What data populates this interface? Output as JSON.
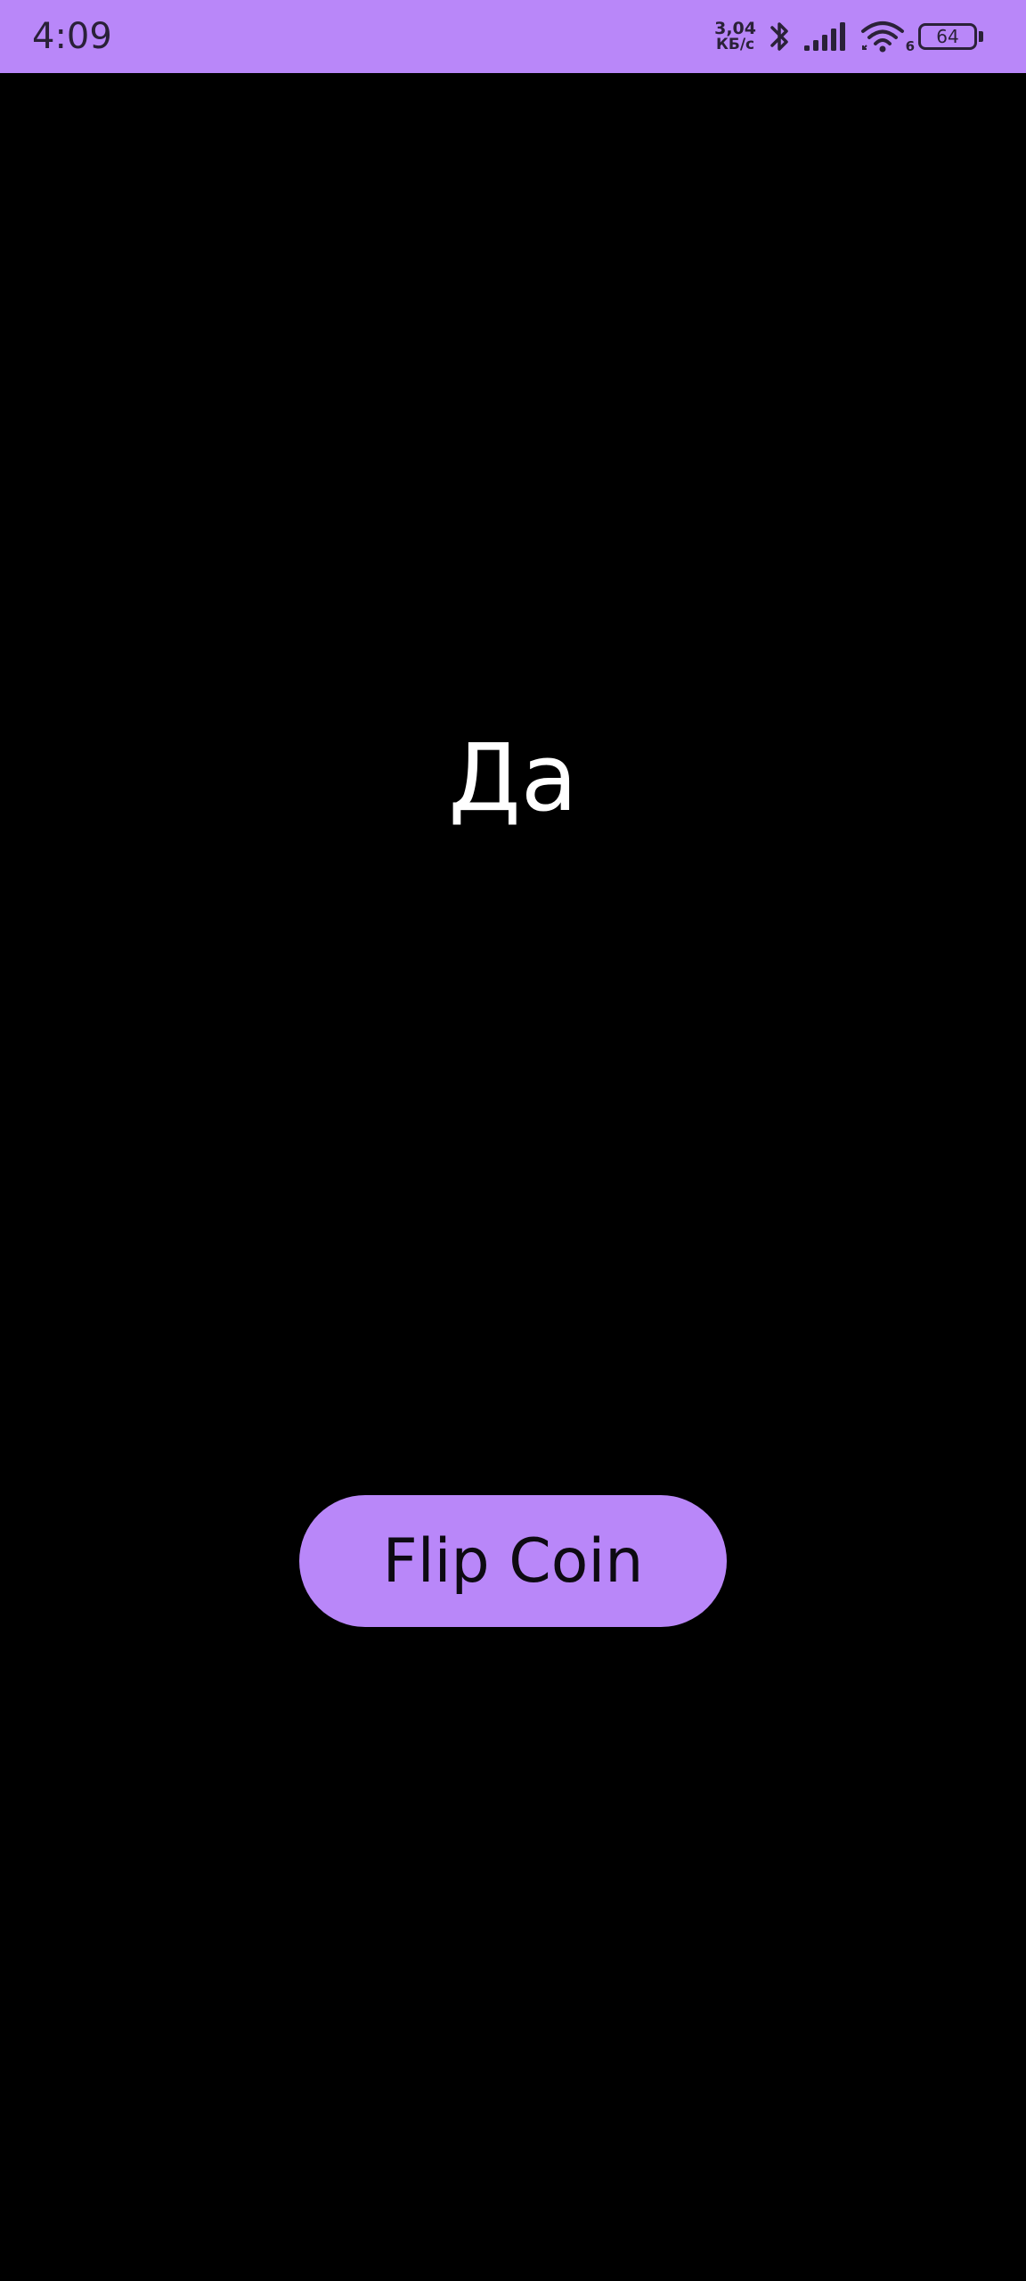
{
  "status_bar": {
    "time": "4:09",
    "net_speed_value": "3,04",
    "net_speed_unit": "КБ/с",
    "battery_level": "64",
    "wifi_label": "6",
    "bg_color": "#b987f9",
    "icons": [
      "bluetooth-icon",
      "signal-icon",
      "wifi-icon",
      "battery-icon"
    ]
  },
  "main": {
    "result_text": "Да",
    "flip_button_label": "Flip Coin",
    "button_color": "#b987f9",
    "background_color": "#000000"
  }
}
